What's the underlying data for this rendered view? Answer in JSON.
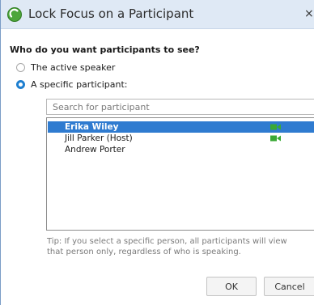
{
  "dialog": {
    "title": "Lock Focus on a Participant",
    "close_glyph": "×"
  },
  "question": "Who do you want participants to see?",
  "options": [
    {
      "label": "The active speaker",
      "selected": false
    },
    {
      "label": "A specific participant:",
      "selected": true
    }
  ],
  "search": {
    "placeholder": "Search for participant",
    "value": ""
  },
  "participants": [
    {
      "name": "Erika Wiley",
      "selected": true,
      "video_icon": "video-camera-icon"
    },
    {
      "name": "Jill Parker (Host)",
      "selected": false,
      "video_icon": "video-camera-icon"
    },
    {
      "name": "Andrew Porter",
      "selected": false,
      "video_icon": null
    }
  ],
  "tip": "Tip: If you select a specific person, all participants will view that person only, regardless of who is speaking.",
  "buttons": {
    "ok": "OK",
    "cancel": "Cancel"
  },
  "colors": {
    "accent": "#1f7fd0",
    "selection": "#2f7bd0",
    "video_green": "#3aa935",
    "titlebar": "#dfe9f5"
  }
}
